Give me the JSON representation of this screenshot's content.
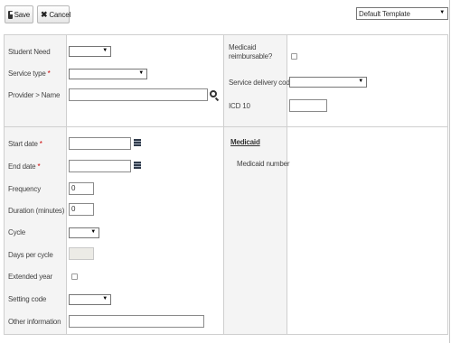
{
  "toolbar": {
    "save_label": "Save",
    "cancel_label": "Cancel",
    "template_value": "Default Template"
  },
  "section1": {
    "left": {
      "student_need_label": "Student Need",
      "service_type_label": "Service type",
      "required_mark": "*",
      "provider_name_label": "Provider > Name"
    },
    "right": {
      "medicaid_reimbursable_label_line1": "Medicaid",
      "medicaid_reimbursable_label_line2": "reimbursable?",
      "service_delivery_code_label": "Service delivery code",
      "icd10_label": "ICD 10"
    }
  },
  "section2": {
    "left": {
      "start_date_label": "Start date",
      "end_date_label": "End date",
      "required_mark": "*",
      "frequency_label": "Frequency",
      "frequency_value": "0",
      "duration_label": "Duration (minutes)",
      "duration_value": "0",
      "cycle_label": "Cycle",
      "days_per_cycle_label": "Days per cycle",
      "extended_year_label": "Extended year",
      "setting_code_label": "Setting code",
      "other_information_label": "Other information"
    },
    "right": {
      "medicaid_heading": "Medicaid",
      "medicaid_number_label": "Medicaid number"
    }
  },
  "icons": {
    "save": "floppy-disk-icon",
    "cancel": "x-icon",
    "dropdown": "triangle-down-icon",
    "lookup": "magnifier-icon",
    "calendar": "calendar-icon"
  }
}
